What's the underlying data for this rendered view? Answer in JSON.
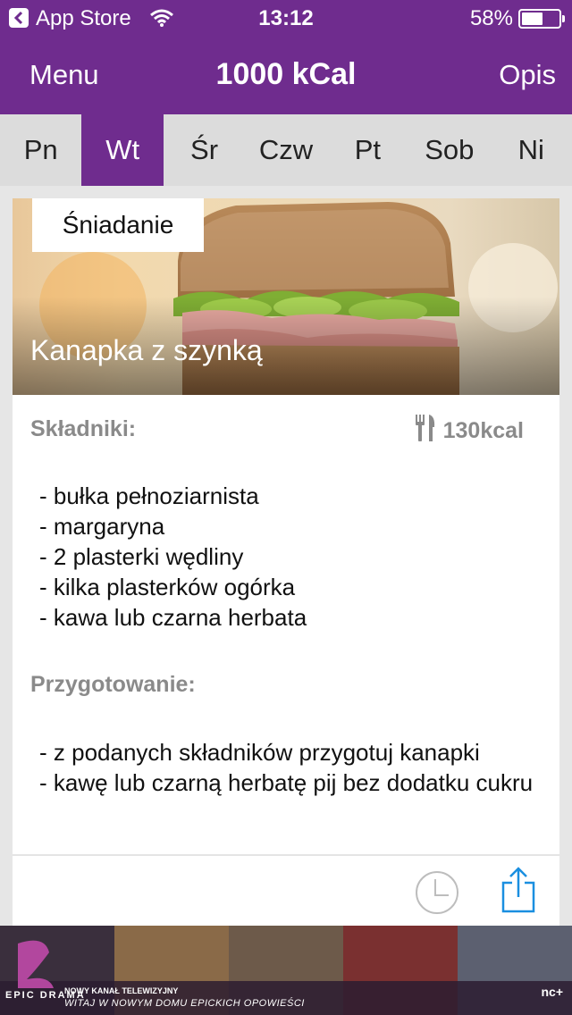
{
  "status_bar": {
    "carrier": "App Store",
    "time": "13:12",
    "battery": "58%",
    "battery_level": 0.58
  },
  "nav": {
    "left": "Menu",
    "title": "1000 kCal",
    "right": "Opis"
  },
  "days": [
    {
      "label": "Pn",
      "active": false
    },
    {
      "label": "Wt",
      "active": true
    },
    {
      "label": "Śr",
      "active": false
    },
    {
      "label": "Czw",
      "active": false
    },
    {
      "label": "Pt",
      "active": false
    },
    {
      "label": "Sob",
      "active": false
    },
    {
      "label": "Ni",
      "active": false
    }
  ],
  "meal": {
    "label": "Śniadanie",
    "name": "Kanapka z szynką",
    "ingredients_title": "Składniki:",
    "kcal": "130kcal",
    "ingredients": [
      "- bułka pełnoziarnista",
      "- margaryna",
      "- 2 plasterki wędliny",
      "- kilka plasterków ogórka",
      "- kawa lub czarna herbata"
    ],
    "preparation_title": "Przygotowanie:",
    "preparation": [
      "- z podanych składników przygotuj kanapki",
      "- kawę lub czarną herbatę pij bez dodatku cukru"
    ]
  },
  "ad": {
    "logo": "EPIC DRAMA",
    "line1": "NOWY KANAŁ TELEWIZYJNY",
    "line2": "WITAJ W NOWYM DOMU EPICKICH OPOWIEŚCI",
    "brand": "nc+"
  },
  "colors": {
    "accent": "#6f2c8e",
    "muted_text": "#8a8a8a",
    "icon_blue": "#1a8fe0"
  }
}
